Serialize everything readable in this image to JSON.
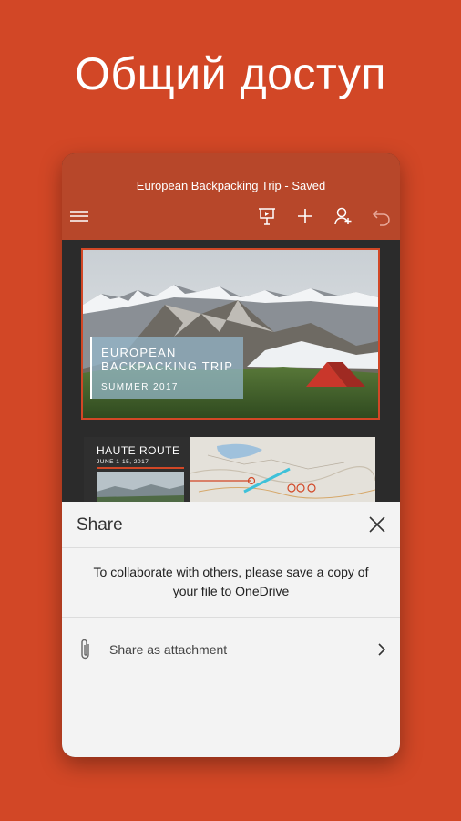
{
  "promo": {
    "headline": "Общий доступ"
  },
  "app": {
    "document_title": "European Backpacking Trip - Saved",
    "accent_color": "#d24726",
    "appbar_color": "#b7472a",
    "toolbar_icons": [
      "hamburger-menu-icon",
      "present-icon",
      "add-icon",
      "share-person-icon",
      "undo-icon"
    ]
  },
  "slides": [
    {
      "title_line1": "EUROPEAN",
      "title_line2": "BACKPACKING TRIP",
      "subtitle": "SUMMER 2017"
    },
    {
      "title": "HAUTE ROUTE",
      "date": "JUNE 1-15, 2017"
    }
  ],
  "share_sheet": {
    "title": "Share",
    "message_line1": "To collaborate with others, please save a copy of",
    "message_line2": "your file to OneDrive",
    "option_label": "Share as attachment",
    "option_icon": "paperclip-icon"
  }
}
